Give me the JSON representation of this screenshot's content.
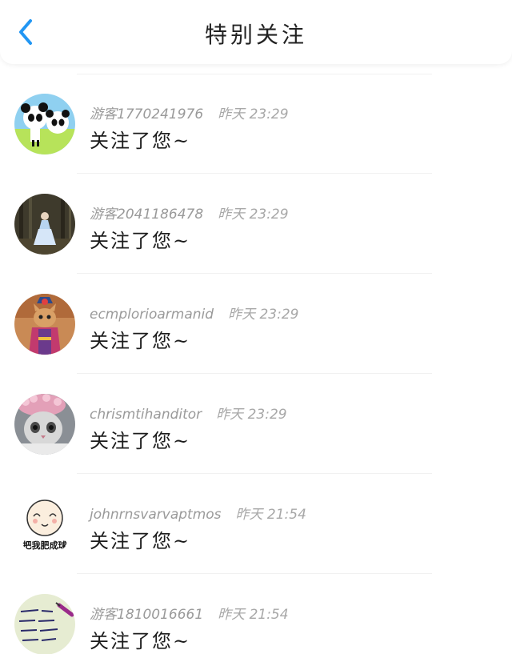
{
  "header": {
    "title": "特别关注",
    "back_icon": "chevron-left-icon",
    "accent_color": "#2196f3"
  },
  "items": [
    {
      "username": "游客1770241976",
      "time": "昨天 23:29",
      "message": "关注了您~",
      "avatar": "panda-avatar"
    },
    {
      "username": "游客2041186478",
      "time": "昨天 23:29",
      "message": "关注了您~",
      "avatar": "forest-girl-avatar"
    },
    {
      "username": "ecmplorioarmanid",
      "time": "昨天 23:29",
      "message": "关注了您~",
      "avatar": "costume-cat-avatar"
    },
    {
      "username": "chrismtihanditor",
      "time": "昨天 23:29",
      "message": "关注了您~",
      "avatar": "cat-in-hat-avatar"
    },
    {
      "username": "johnrnsvarvaptmos",
      "time": "昨天 21:54",
      "message": "关注了您~",
      "avatar": "cartoon-face-avatar",
      "avatar_text": "把我肥成球"
    },
    {
      "username": "游客1810016661",
      "time": "昨天 21:54",
      "message": "关注了您~",
      "avatar": "handwriting-avatar"
    }
  ]
}
